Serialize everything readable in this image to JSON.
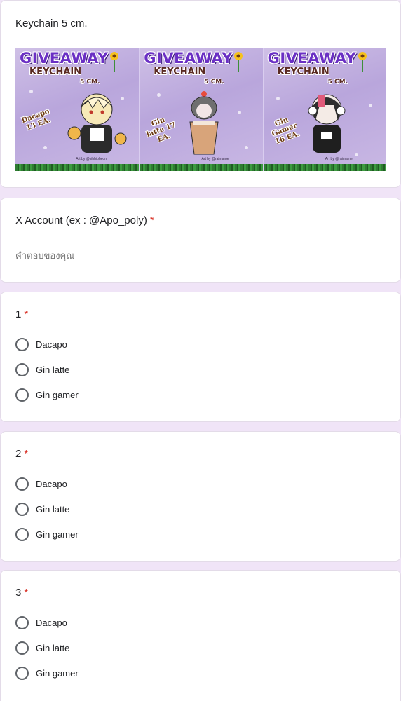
{
  "form": {
    "header": {
      "title": "Keychain 5 cm.",
      "banner": {
        "panels": [
          {
            "heading": "GIVEAWAY",
            "subheading": "KEYCHAIN",
            "size": "5 CM.",
            "tag": "Dacapo 13 EA.",
            "credit": "Art by @sibbipheon",
            "character": "blonde-boy-with-cats"
          },
          {
            "heading": "GIVEAWAY",
            "subheading": "KEYCHAIN",
            "size": "5 CM.",
            "tag": "Gin latte 17 EA.",
            "credit": "Art by @raimame",
            "character": "latte-cup-character"
          },
          {
            "heading": "GIVEAWAY",
            "subheading": "KEYCHAIN",
            "size": "5 CM.",
            "tag": "Gin Gamer 16 EA.",
            "credit": "Art by @raimame",
            "character": "gamer-with-headphones"
          }
        ]
      }
    },
    "questions": [
      {
        "label": "X Account (ex : @Apo_poly)",
        "required_mark": "*",
        "type": "short-answer",
        "placeholder": "คำตอบของคุณ"
      },
      {
        "label": "1",
        "required_mark": "*",
        "type": "radio",
        "options": [
          "Dacapo",
          "Gin latte",
          "Gin gamer"
        ]
      },
      {
        "label": "2",
        "required_mark": "*",
        "type": "radio",
        "options": [
          "Dacapo",
          "Gin latte",
          "Gin gamer"
        ]
      },
      {
        "label": "3",
        "required_mark": "*",
        "type": "radio",
        "options": [
          "Dacapo",
          "Gin latte",
          "Gin gamer"
        ]
      }
    ]
  },
  "colors": {
    "page_background": "#f0e4f7",
    "required_asterisk": "#d93025",
    "radio_border": "#5f6368",
    "giveaway_heading": "#6a2fc4"
  }
}
